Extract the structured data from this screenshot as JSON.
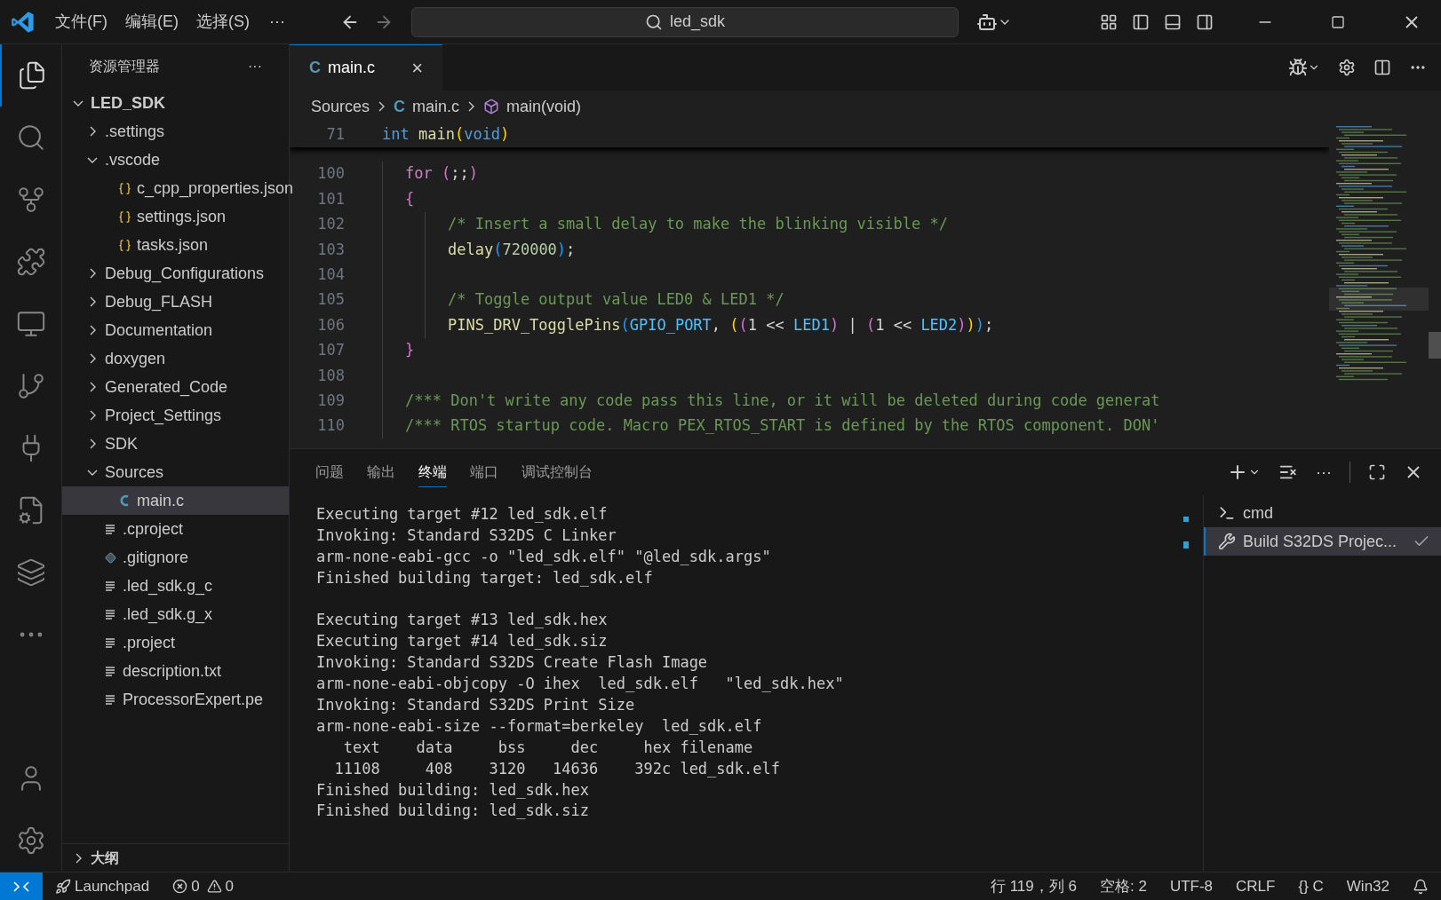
{
  "title_bar": {
    "menus": [
      "文件(F)",
      "编辑(E)",
      "选择(S)"
    ],
    "more": "···",
    "search": "led_sdk"
  },
  "sidebar": {
    "title": "资源管理器",
    "more": "···",
    "tree": [
      {
        "label": "LED_SDK",
        "kind": "root",
        "expanded": true,
        "children": [
          {
            "label": ".settings",
            "kind": "folder",
            "expanded": false
          },
          {
            "label": ".vscode",
            "kind": "folder",
            "expanded": true,
            "children": [
              {
                "label": "c_cpp_properties.json",
                "kind": "json"
              },
              {
                "label": "settings.json",
                "kind": "json"
              },
              {
                "label": "tasks.json",
                "kind": "json"
              }
            ]
          },
          {
            "label": "Debug_Configurations",
            "kind": "folder",
            "expanded": false
          },
          {
            "label": "Debug_FLASH",
            "kind": "folder",
            "expanded": false
          },
          {
            "label": "Documentation",
            "kind": "folder",
            "expanded": false
          },
          {
            "label": "doxygen",
            "kind": "folder",
            "expanded": false
          },
          {
            "label": "Generated_Code",
            "kind": "folder",
            "expanded": false
          },
          {
            "label": "Project_Settings",
            "kind": "folder",
            "expanded": false
          },
          {
            "label": "SDK",
            "kind": "folder",
            "expanded": false
          },
          {
            "label": "Sources",
            "kind": "folder",
            "expanded": true,
            "children": [
              {
                "label": "main.c",
                "kind": "c",
                "selected": true
              }
            ]
          },
          {
            "label": ".cproject",
            "kind": "file",
            "selected": false
          },
          {
            "label": ".gitignore",
            "kind": "git",
            "selected": false
          },
          {
            "label": ".led_sdk.g_c",
            "kind": "file",
            "selected": false
          },
          {
            "label": ".led_sdk.g_x",
            "kind": "file",
            "selected": false
          },
          {
            "label": ".project",
            "kind": "file",
            "selected": false
          },
          {
            "label": "description.txt",
            "kind": "file",
            "selected": false
          },
          {
            "label": "ProcessorExpert.pe",
            "kind": "file",
            "selected": false
          }
        ]
      }
    ],
    "outline": {
      "label": "大纲",
      "expanded": false
    }
  },
  "editor": {
    "tab": {
      "icon": "C",
      "label": "main.c",
      "close": "×"
    },
    "breadcrumbs": [
      {
        "label": "Sources"
      },
      {
        "icon": "C",
        "label": "main.c"
      },
      {
        "label": "main(void)"
      }
    ],
    "sticky": {
      "number": "71",
      "tokens": [
        {
          "text": "int ",
          "kind": "kw"
        },
        {
          "text": "main",
          "kind": "fn"
        },
        {
          "text": "(",
          "kind": "p1"
        },
        {
          "text": "void",
          "kind": "kw"
        },
        {
          "text": ")",
          "kind": "p1"
        }
      ]
    },
    "lines": [
      {
        "number": "100",
        "kind": "outer",
        "tokens": [
          {
            "text": "for ",
            "kind": "ctl"
          },
          {
            "text": "(",
            "kind": "p2"
          },
          {
            "text": ";;",
            "kind": "plain"
          },
          {
            "text": ")",
            "kind": "p2"
          }
        ]
      },
      {
        "number": "101",
        "kind": "outer",
        "tokens": [
          {
            "text": "{",
            "kind": "p2"
          }
        ]
      },
      {
        "number": "102",
        "kind": "inner",
        "tokens": [
          {
            "text": "/* Insert a small delay to make the blinking visible */",
            "kind": "cm"
          }
        ]
      },
      {
        "number": "103",
        "kind": "inner",
        "tokens": [
          {
            "text": "delay",
            "kind": "fn"
          },
          {
            "text": "(",
            "kind": "p3"
          },
          {
            "text": "720000",
            "kind": "num"
          },
          {
            "text": ")",
            "kind": "p3"
          },
          {
            "text": ";",
            "kind": "plain"
          }
        ]
      },
      {
        "number": "104",
        "kind": "inner"
      },
      {
        "number": "105",
        "kind": "inner",
        "tokens": [
          {
            "text": "/* Toggle output value LED0 & LED1 */",
            "kind": "cm"
          }
        ]
      },
      {
        "number": "106",
        "kind": "inner",
        "tokens": [
          {
            "text": "PINS_DRV_TogglePins",
            "kind": "fn"
          },
          {
            "text": "(",
            "kind": "p3"
          },
          {
            "text": "GPIO_PORT",
            "kind": "mac"
          },
          {
            "text": ", ",
            "kind": "plain"
          },
          {
            "text": "(",
            "kind": "p1"
          },
          {
            "text": "(",
            "kind": "p2"
          },
          {
            "text": "1 << ",
            "kind": "plain"
          },
          {
            "text": "LED1",
            "kind": "mac"
          },
          {
            "text": ")",
            "kind": "p2"
          },
          {
            "text": " | ",
            "kind": "plain"
          },
          {
            "text": "(",
            "kind": "p2"
          },
          {
            "text": "1 << ",
            "kind": "plain"
          },
          {
            "text": "LED2",
            "kind": "mac"
          },
          {
            "text": ")",
            "kind": "p2"
          },
          {
            "text": ")",
            "kind": "p1"
          },
          {
            "text": ")",
            "kind": "p3"
          },
          {
            "text": ";",
            "kind": "plain"
          }
        ]
      },
      {
        "number": "107",
        "kind": "outer",
        "tokens": [
          {
            "text": "}",
            "kind": "p2"
          }
        ]
      },
      {
        "number": "108",
        "kind": "outer"
      },
      {
        "number": "109",
        "kind": "outer",
        "tokens": [
          {
            "text": "/*** Don't write any code pass this line, or it will be deleted during code generat",
            "kind": "cm"
          }
        ]
      },
      {
        "number": "110",
        "kind": "outer",
        "tokens": [
          {
            "text": "/*** RTOS startup code. Macro PEX_RTOS_START is defined by the RTOS component. DON'",
            "kind": "cm"
          }
        ]
      }
    ]
  },
  "panel": {
    "tabs": [
      {
        "label": "问题",
        "selected": false
      },
      {
        "label": "输出",
        "selected": false
      },
      {
        "label": "终端",
        "selected": true
      },
      {
        "label": "端口",
        "selected": false
      },
      {
        "label": "调试控制台",
        "selected": false
      }
    ],
    "more": "···",
    "terminal": [
      {
        "lines": [
          "Executing target #12 led_sdk.elf",
          "Invoking: Standard S32DS C Linker",
          "arm-none-eabi-gcc -o \"led_sdk.elf\" \"@led_sdk.args\"",
          "Finished building target: led_sdk.elf"
        ]
      },
      {
        "lines": [
          "Executing target #13 led_sdk.hex",
          "Executing target #14 led_sdk.siz",
          "Invoking: Standard S32DS Create Flash Image",
          "arm-none-eabi-objcopy -O ihex  led_sdk.elf   \"led_sdk.hex\"",
          "Invoking: Standard S32DS Print Size",
          "arm-none-eabi-size --format=berkeley  led_sdk.elf",
          "   text\t   data\t    bss\t    dec\t    hex filename",
          "  11108\t    408\t   3120\t  14636\t   392c led_sdk.elf",
          "Finished building: led_sdk.hex",
          "Finished building: led_sdk.siz"
        ]
      }
    ],
    "sessions": [
      {
        "label": "cmd",
        "kind": "cmd",
        "selected": false
      },
      {
        "label": "Build S32DS Projec...",
        "kind": "task",
        "selected": true,
        "done": true
      }
    ]
  },
  "status_bar": {
    "launchpad": "Launchpad",
    "errors": "0",
    "warnings": "0",
    "items": [
      "行 119，列 6",
      "空格: 2",
      "UTF-8",
      "CRLF",
      "{} C",
      "Win32"
    ]
  }
}
